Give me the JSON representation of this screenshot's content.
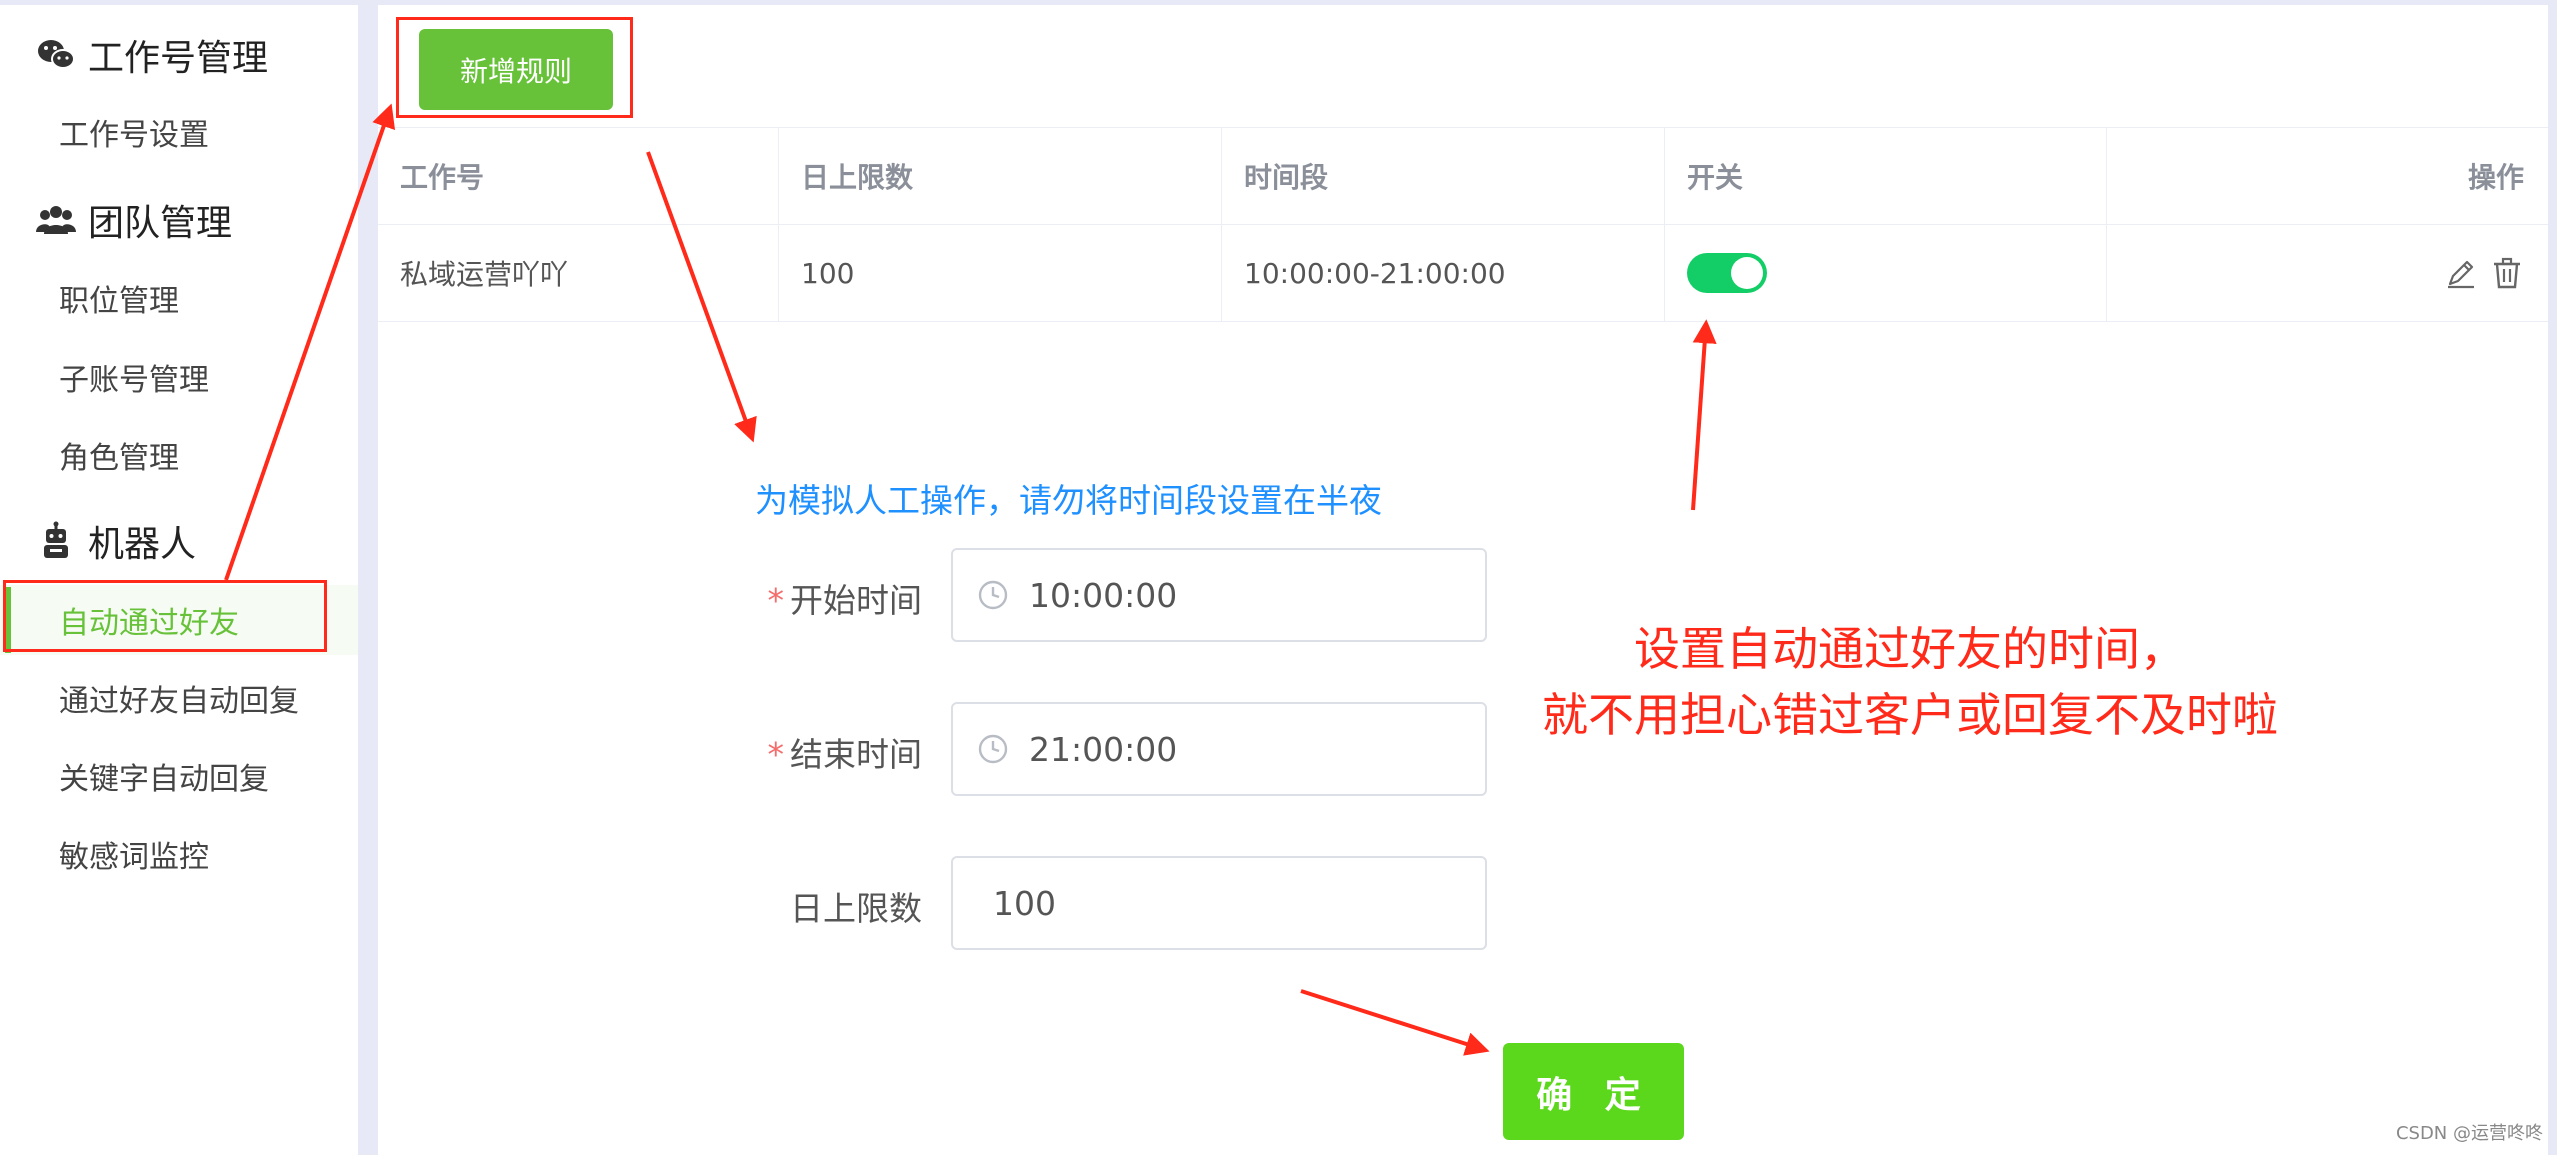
{
  "sidebar": {
    "groups": [
      {
        "title": "工作号管理",
        "icon": "wechat-icon",
        "items": [
          "工作号设置"
        ]
      },
      {
        "title": "团队管理",
        "icon": "team-icon",
        "items": [
          "职位管理",
          "子账号管理",
          "角色管理"
        ]
      },
      {
        "title": "机器人",
        "icon": "robot-icon",
        "items": [
          "自动通过好友",
          "通过好友自动回复",
          "关键字自动回复",
          "敏感词监控"
        ]
      }
    ],
    "active_item": "自动通过好友"
  },
  "toolbar": {
    "add_rule_label": "新增规则"
  },
  "table": {
    "columns": [
      "工作号",
      "日上限数",
      "时间段",
      "开关",
      "操作"
    ],
    "rows": [
      {
        "account": "私域运营吖吖",
        "daily_limit": "100",
        "time_range": "10:00:00-21:00:00",
        "switch_on": true
      }
    ]
  },
  "form": {
    "note": "为模拟人工操作，请勿将时间段设置在半夜",
    "start_time_label": "开始时间",
    "start_time_value": "10:00:00",
    "end_time_label": "结束时间",
    "end_time_value": "21:00:00",
    "daily_limit_label": "日上限数",
    "daily_limit_value": "100",
    "required_mark": "*",
    "confirm_label": "确 定"
  },
  "annotation": {
    "line1": "设置自动通过好友的时间，",
    "line2": "就不用担心错过客户或回复不及时啦",
    "color": "#ff2a1a"
  },
  "watermark": "CSDN @运营咚咚",
  "colors": {
    "accent": "#67c23a",
    "switch": "#13ce66",
    "note": "#1e90ff",
    "required": "#f56c6c"
  }
}
